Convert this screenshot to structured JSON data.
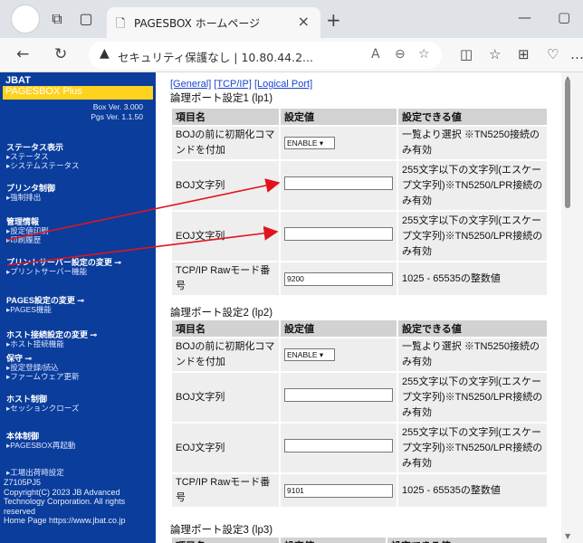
{
  "browser": {
    "tab_title": "PAGESBOX ホームページ",
    "security_label": "セキュリティ保護なし",
    "address": "10.80.44.2..."
  },
  "sidebar": {
    "brand": "JBAT",
    "product": "PAGESBOX Plus",
    "box_ver": "Box Ver. 3.000",
    "pgs_ver": "Pgs Ver. 1.1.50",
    "sections": [
      {
        "head": "ステータス表示",
        "subs": [
          "▸ステータス",
          "▸システムステータス"
        ]
      },
      {
        "head": "プリンタ制御",
        "subs": [
          "▸強制排出"
        ]
      },
      {
        "head": "管理情報",
        "subs": [
          "▸設定値印刷",
          "▸印刷履歴"
        ]
      },
      {
        "head": "プリントサーバー設定の変更 ⊸",
        "subs": [
          "▸プリントサーバー機能"
        ]
      },
      {
        "head": "PAGES設定の変更 ⊸",
        "subs": [
          "▸PAGES機能"
        ]
      },
      {
        "head": "ホスト接続設定の変更 ⊸",
        "subs": [
          "▸ホスト接続機能"
        ]
      },
      {
        "head": "保守 ⊸",
        "subs": [
          "▸設定登録/読込",
          "▸ファームウェア更新"
        ]
      },
      {
        "head": "ホスト制御",
        "subs": [
          "▸セッションクローズ"
        ]
      },
      {
        "head": "本体制御",
        "subs": [
          "▸PAGESBOX再起動"
        ]
      },
      {
        "head": "",
        "subs": [
          "▸工場出荷時設定"
        ]
      }
    ],
    "footer": [
      "Z7105PJ5",
      "Copyright(C) 2023 JB Advanced",
      "Technology Corporation. All rights",
      "reserved",
      "Home Page https://www.jbat.co.jp"
    ]
  },
  "main": {
    "links": [
      "[General]",
      "[TCP/IP]",
      "[Logical Port]"
    ],
    "headers": [
      "項目名",
      "設定値",
      "設定できる値"
    ],
    "ports": [
      {
        "title": "論理ポート設定1 (lp1)",
        "rows": [
          {
            "name": "BOJの前に初期化コマンドを付加",
            "value": "ENABLE ▾",
            "range": "一覧より選択 ※TN5250接続のみ有効"
          },
          {
            "name": "BOJ文字列",
            "value": "",
            "range": "255文字以下の文字列(エスケープ文字列)※TN5250/LPR接続のみ有効"
          },
          {
            "name": "EOJ文字列",
            "value": "",
            "range": "255文字以下の文字列(エスケープ文字列)※TN5250/LPR接続のみ有効"
          },
          {
            "name": "TCP/IP Rawモード番号",
            "value": "9200",
            "range": "1025 - 65535の整数値"
          }
        ]
      },
      {
        "title": "論理ポート設定2 (lp2)",
        "rows": [
          {
            "name": "BOJの前に初期化コマンドを付加",
            "value": "ENABLE ▾",
            "range": "一覧より選択 ※TN5250接続のみ有効"
          },
          {
            "name": "BOJ文字列",
            "value": "",
            "range": "255文字以下の文字列(エスケープ文字列)※TN5250/LPR接続のみ有効"
          },
          {
            "name": "EOJ文字列",
            "value": "",
            "range": "255文字以下の文字列(エスケープ文字列)※TN5250/LPR接続のみ有効"
          },
          {
            "name": "TCP/IP Rawモード番号",
            "value": "9101",
            "range": "1025 - 65535の整数値"
          }
        ]
      },
      {
        "title": "論理ポート設定3 (lp3)",
        "rows": []
      }
    ]
  },
  "colors": {
    "sidebar": "#0a3d9c",
    "brand_bar": "#ffd21e",
    "arrow": "#e0141e"
  }
}
